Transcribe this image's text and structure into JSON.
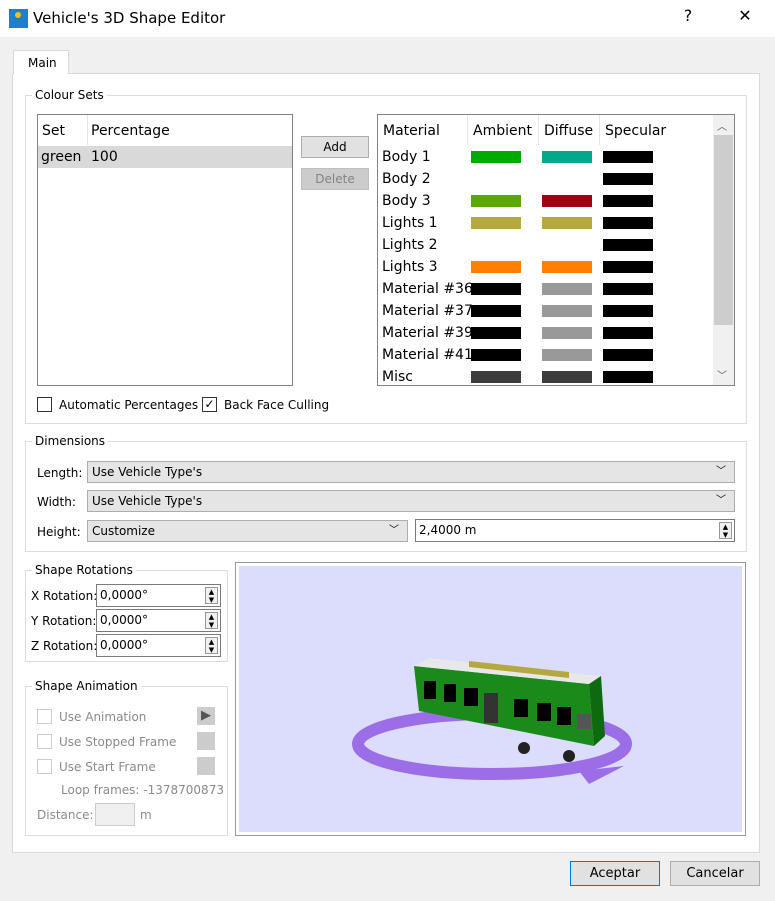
{
  "window": {
    "title": "Vehicle's 3D Shape Editor",
    "help": "?",
    "close": "✕"
  },
  "tabs": [
    {
      "label": "Main"
    }
  ],
  "colour_sets": {
    "label": "Colour Sets",
    "set_headers": [
      "Set",
      "Percentage"
    ],
    "sets": [
      {
        "set": "green",
        "percentage": "100"
      }
    ],
    "add": "Add",
    "delete": "Delete",
    "material_headers": [
      "Material",
      "Ambient",
      "Diffuse",
      "Specular"
    ],
    "materials": [
      {
        "name": "Body 1",
        "ambient": "#00aa00",
        "diffuse": "#00a88c",
        "specular": "#000000"
      },
      {
        "name": "Body 2",
        "ambient": "",
        "diffuse": "",
        "specular": "#000000"
      },
      {
        "name": "Body 3",
        "ambient": "#5aa800",
        "diffuse": "#a00012",
        "specular": "#000000"
      },
      {
        "name": "Lights 1",
        "ambient": "#b4a840",
        "diffuse": "#b4a840",
        "specular": "#000000"
      },
      {
        "name": "Lights 2",
        "ambient": "",
        "diffuse": "",
        "specular": "#000000"
      },
      {
        "name": "Lights 3",
        "ambient": "#ff8000",
        "diffuse": "#ff8000",
        "specular": "#000000"
      },
      {
        "name": "Material #36",
        "ambient": "#000000",
        "diffuse": "#999999",
        "specular": "#000000"
      },
      {
        "name": "Material #37",
        "ambient": "#000000",
        "diffuse": "#999999",
        "specular": "#000000"
      },
      {
        "name": "Material #39",
        "ambient": "#000000",
        "diffuse": "#999999",
        "specular": "#000000"
      },
      {
        "name": "Material #41",
        "ambient": "#000000",
        "diffuse": "#999999",
        "specular": "#000000"
      },
      {
        "name": "Misc",
        "ambient": "#3c3c3c",
        "diffuse": "#3c3c3c",
        "specular": "#000000"
      }
    ],
    "auto_percentages": {
      "label": "Automatic Percentages",
      "checked": false
    },
    "back_face_culling": {
      "label": "Back Face Culling",
      "checked": true
    }
  },
  "dimensions": {
    "label": "Dimensions",
    "length": {
      "label": "Length:",
      "value": "Use Vehicle Type's"
    },
    "width": {
      "label": "Width:",
      "value": "Use Vehicle Type's"
    },
    "height": {
      "label": "Height:",
      "value": "Customize",
      "custom": "2,4000 m"
    }
  },
  "rotations": {
    "label": "Shape Rotations",
    "x": {
      "label": "X Rotation:",
      "value": "0,0000°"
    },
    "y": {
      "label": "Y Rotation:",
      "value": "0,0000°"
    },
    "z": {
      "label": "Z Rotation:",
      "value": "0,0000°"
    }
  },
  "animation": {
    "label": "Shape Animation",
    "use_animation": "Use Animation",
    "use_stopped": "Use Stopped Frame",
    "use_start": "Use Start Frame",
    "loop_frames": "Loop frames: -1378700873",
    "distance_label": "Distance:",
    "distance_unit": "m"
  },
  "preview": {
    "background": "#dcdcfc"
  },
  "footer": {
    "ok": "Aceptar",
    "cancel": "Cancelar"
  }
}
